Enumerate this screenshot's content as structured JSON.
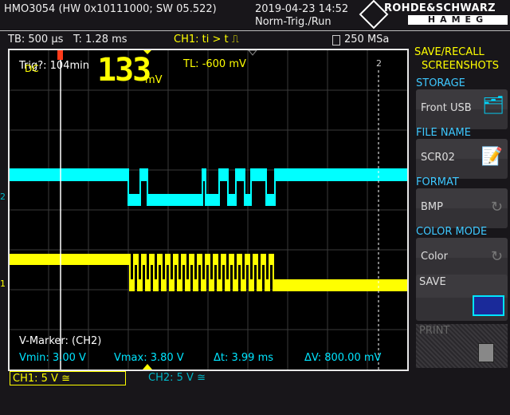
{
  "header": {
    "device": "HMO3054 (HW 0x10111000; SW 05.522)",
    "datetime": "2019-04-23 14:52",
    "trigger_status": "Norm-Trig./Run",
    "brand_line1": "ROHDE&SCHWARZ",
    "brand_line2": "HAMEG"
  },
  "status_bar": {
    "timebase": "TB: 500 µs",
    "time": "T: 1.28 ms",
    "trigger": "CH1: ti > t ⎍",
    "sample_rate": "250 MSa"
  },
  "screen": {
    "trig_info": "Trig?: 104min",
    "coupling": "DC",
    "big_value": "133",
    "big_unit": "mV",
    "trigger_level": "TL:  -600 mV",
    "marker_2": "2",
    "ch2_marker": "2",
    "ch1_marker": "1",
    "vmarker": {
      "title": "V-Marker: (CH2)",
      "vmin": "Vmin: 3.00 V",
      "vmax": "Vmax: 3.80 V",
      "dt": "Δt: 3.99 ms",
      "dv": "ΔV: 800.00 mV"
    }
  },
  "channels": [
    {
      "label": "CH1: 5 V ≅",
      "color": "#ffff00",
      "active": true
    },
    {
      "label": "CH2: 5 V ≅",
      "color": "#00b8c8",
      "active": false
    }
  ],
  "menu": {
    "title1": "SAVE/RECALL",
    "title2": "SCREENSHOTS",
    "items": [
      {
        "section": "STORAGE",
        "value": "Front USB",
        "icon": "folder-tree-icon"
      },
      {
        "section": "FILE NAME",
        "value": "SCR02",
        "icon": "notepad-pen-icon"
      },
      {
        "section": "FORMAT",
        "value": "BMP",
        "icon": "cycle-arrow-icon"
      },
      {
        "section": "COLOR MODE",
        "value": "Color",
        "icon": "cycle-arrow-icon"
      }
    ],
    "save": "SAVE",
    "print": "PRINT"
  },
  "colors": {
    "ch1": "#ffff00",
    "ch2": "#00ffff",
    "accent": "#3ec8ff"
  }
}
